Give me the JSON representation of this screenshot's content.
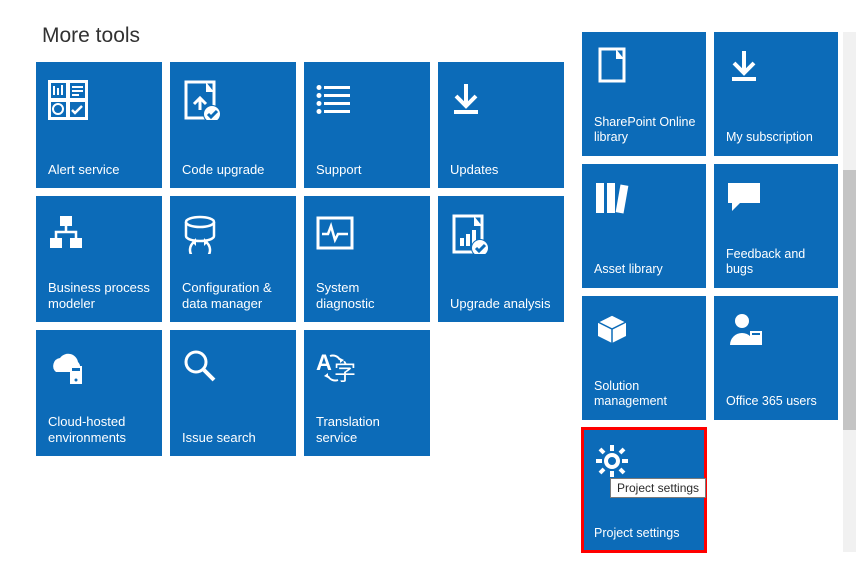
{
  "title": "More tools",
  "left_tiles": [
    {
      "label": "Alert service",
      "icon": "alert-service"
    },
    {
      "label": "Code upgrade",
      "icon": "code-upgrade"
    },
    {
      "label": "Support",
      "icon": "support"
    },
    {
      "label": "Updates",
      "icon": "updates"
    },
    {
      "label": "Business process modeler",
      "icon": "bpm"
    },
    {
      "label": "Configuration & data manager",
      "icon": "config-data"
    },
    {
      "label": "System diagnostic",
      "icon": "sys-diag"
    },
    {
      "label": "Upgrade analysis",
      "icon": "upgrade-analysis"
    },
    {
      "label": "Cloud-hosted environments",
      "icon": "cloud-env"
    },
    {
      "label": "Issue search",
      "icon": "issue-search"
    },
    {
      "label": "Translation service",
      "icon": "translation"
    }
  ],
  "right_tiles": [
    {
      "label": "SharePoint Online library",
      "icon": "sharepoint-doc"
    },
    {
      "label": "My subscription",
      "icon": "subscription"
    },
    {
      "label": "Asset library",
      "icon": "asset-library"
    },
    {
      "label": "Feedback and bugs",
      "icon": "feedback"
    },
    {
      "label": "Solution management",
      "icon": "solution"
    },
    {
      "label": "Office 365 users",
      "icon": "o365-users"
    },
    {
      "label": "Project settings",
      "icon": "settings",
      "highlighted": true,
      "tooltip": "Project settings"
    }
  ],
  "colors": {
    "tile": "#0c6bb8",
    "highlight": "#ff0000"
  }
}
